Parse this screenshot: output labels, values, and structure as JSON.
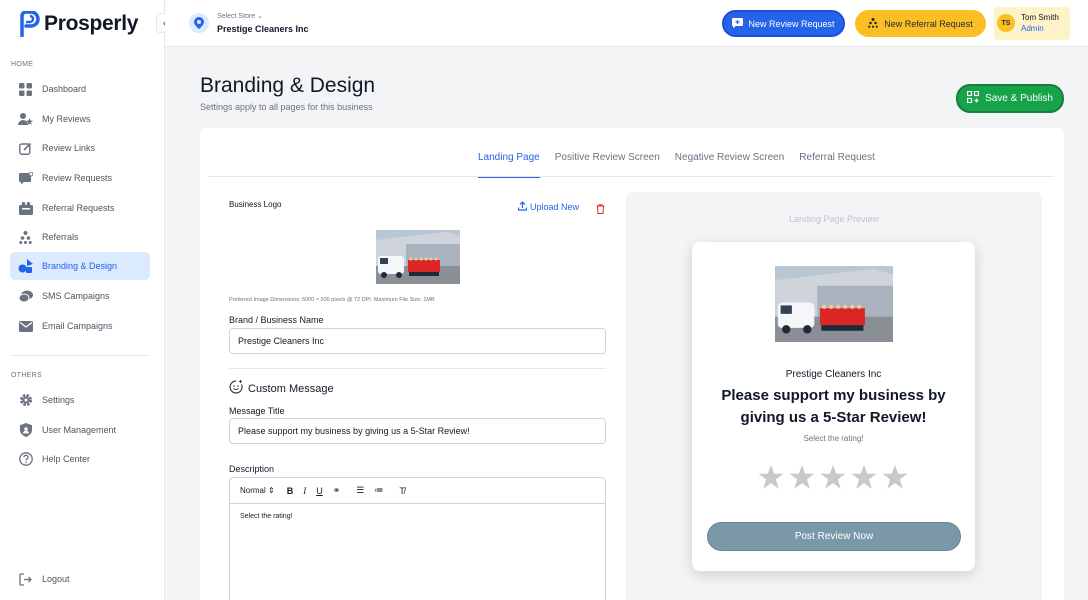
{
  "app": {
    "name": "Prosperly"
  },
  "sidebar": {
    "section_home": "HOME",
    "section_others": "OTHERS",
    "items": [
      {
        "label": "Dashboard",
        "icon": "dashboard-icon"
      },
      {
        "label": "My Reviews",
        "icon": "reviews-icon"
      },
      {
        "label": "Review Links",
        "icon": "edit-icon"
      },
      {
        "label": "Review Requests",
        "icon": "chat-icon"
      },
      {
        "label": "Referral Requests",
        "icon": "referral-icon"
      },
      {
        "label": "Referrals",
        "icon": "hierarchy-icon"
      },
      {
        "label": "Branding & Design",
        "icon": "palette-icon"
      },
      {
        "label": "SMS Campaigns",
        "icon": "sms-icon"
      },
      {
        "label": "Email Campaigns",
        "icon": "mail-icon"
      }
    ],
    "others": [
      {
        "label": "Settings",
        "icon": "gear-icon"
      },
      {
        "label": "User Management",
        "icon": "shield-icon"
      },
      {
        "label": "Help Center",
        "icon": "help-icon"
      }
    ],
    "logout": "Logout",
    "active_item": "Branding & Design"
  },
  "header": {
    "store_label": "Select Store",
    "store_name": "Prestige Cleaners Inc",
    "new_review_request": "New Review Request",
    "new_referral_request": "New Referral Request",
    "user_initials": "TS",
    "user_name": "Tom Smith",
    "user_role": "Admin",
    "colors": {
      "review_button": "#2563eb",
      "referral_button": "#fbbf24"
    }
  },
  "page": {
    "title": "Branding & Design",
    "subtitle": "Settings apply to all pages for this business",
    "save_button": "Save & Publish",
    "save_color": "#16a34a"
  },
  "tabs": [
    {
      "label": "Landing Page",
      "active": true
    },
    {
      "label": "Positive Review Screen",
      "active": false
    },
    {
      "label": "Negative Review Screen",
      "active": false
    },
    {
      "label": "Referral Request",
      "active": false
    }
  ],
  "form": {
    "business_logo_label": "Business Logo",
    "upload_new": "Upload New",
    "image_hint": "Preferred Image Dimensions: 5000 × 500 pixels @ 72 DPI. Maximum File Size: 1MB",
    "brand_name_label": "Brand / Business Name",
    "brand_name_value": "Prestige Cleaners Inc",
    "custom_message_heading": "Custom Message",
    "message_title_label": "Message Title",
    "message_title_value": "Please support my business by giving us a 5-Star Review!",
    "description_label": "Description",
    "editor_format": "Normal",
    "description_value": "Select the rating!"
  },
  "preview": {
    "label": "Landing Page Preview",
    "business_name": "Prestige Cleaners Inc",
    "title": "Please support my business by giving us a 5-Star Review!",
    "subtitle": "Select the rating!",
    "rating_selected": 0,
    "rating_max": 5,
    "button": "Post Review Now",
    "button_color": "#7a98a8"
  }
}
